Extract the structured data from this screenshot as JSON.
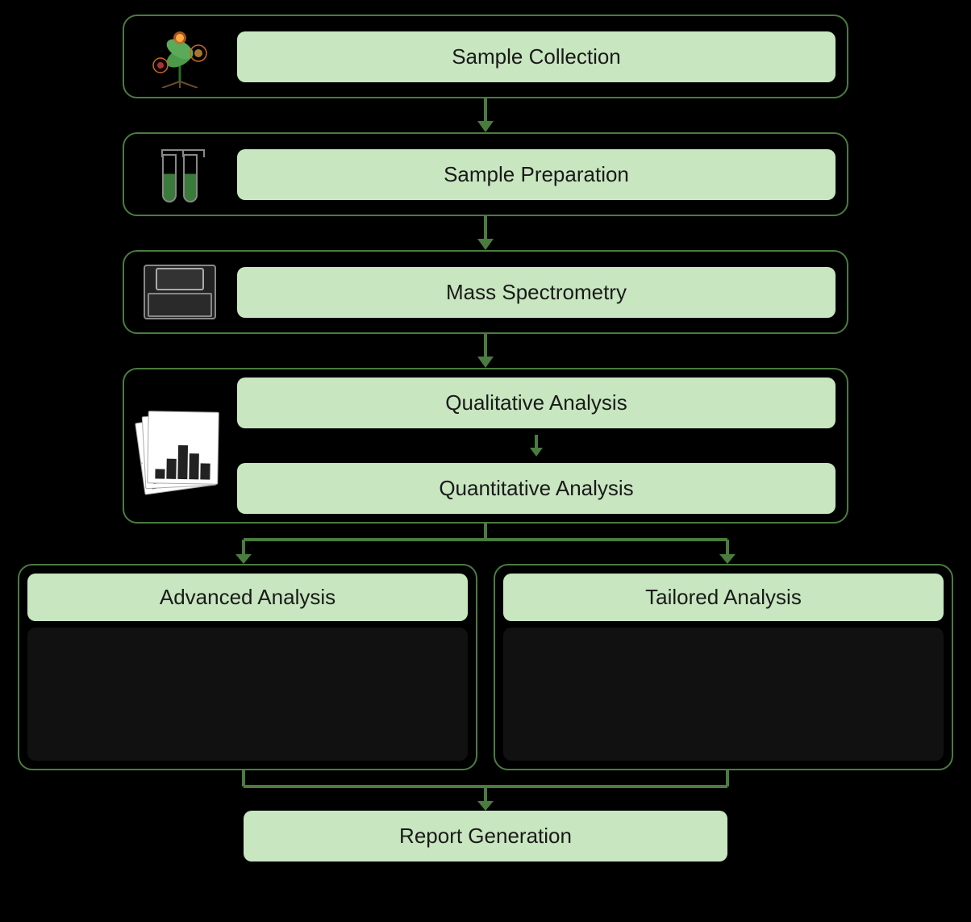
{
  "steps": {
    "sample_collection": "Sample Collection",
    "sample_preparation": "Sample Preparation",
    "mass_spectrometry": "Mass Spectrometry",
    "qualitative_analysis": "Qualitative Analysis",
    "quantitative_analysis": "Quantitative Analysis",
    "advanced_analysis": "Advanced Analysis",
    "tailored_analysis": "Tailored Analysis",
    "report_generation": "Report Generation"
  },
  "colors": {
    "border": "#4a7c3f",
    "label_bg": "#c8e6c0",
    "background": "#000000",
    "arrow": "#4a7c3f"
  }
}
